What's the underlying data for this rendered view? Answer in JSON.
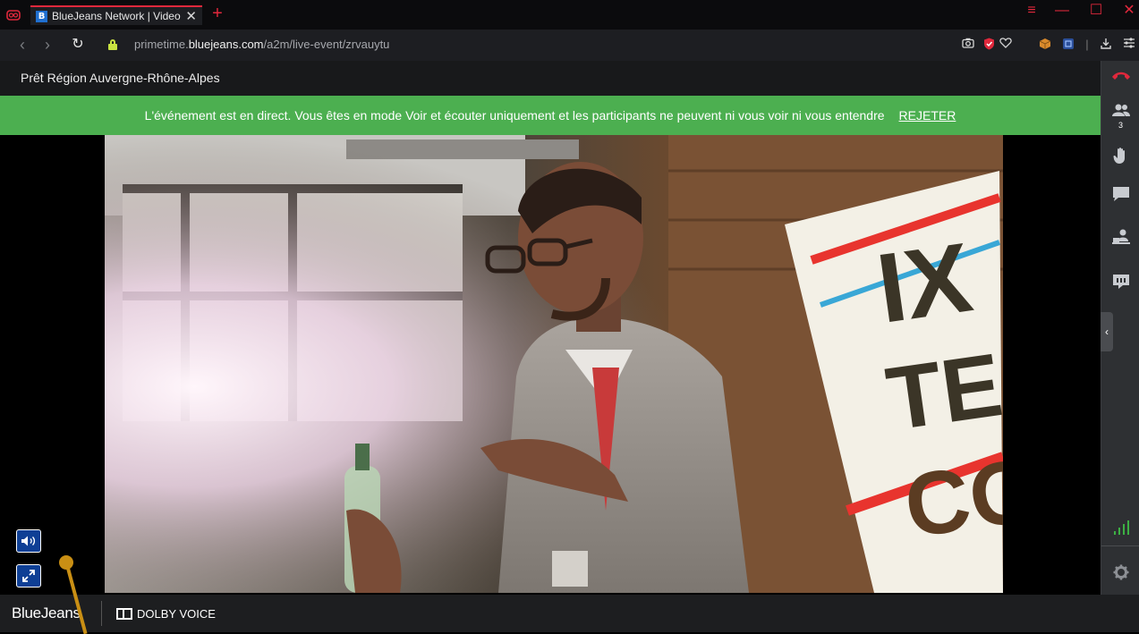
{
  "browser": {
    "tab": {
      "favicon": "B",
      "title": "BlueJeans Network | Video",
      "close_label": "✕"
    },
    "new_tab_label": "+",
    "window_controls": {
      "menu": "≡",
      "minimize": "—",
      "maximize": "☐",
      "close": "✕"
    },
    "url": {
      "prefix": "primetime.",
      "domain": "bluejeans.com",
      "path": "/a2m/live-event/zrvauytu"
    }
  },
  "meeting": {
    "title": "Prêt Région Auvergne-Rhône-Alpes",
    "notice": {
      "text": "L'événement est en direct. Vous êtes en mode Voir et écouter uniquement et les participants ne peuvent ni vous voir ni vous entendre",
      "dismiss_label": "REJETER"
    },
    "video": {
      "banner_text_1": "IX",
      "banner_text_2": "TE",
      "banner_text_3": "CO"
    },
    "controls": {
      "volume_icon": "speaker-icon",
      "fullscreen_icon": "expand-icon"
    },
    "sidebar": {
      "participants_count": "3",
      "items": [
        {
          "icon": "hangup-icon"
        },
        {
          "icon": "participants-icon"
        },
        {
          "icon": "raise-hand-icon"
        },
        {
          "icon": "chat-icon"
        },
        {
          "icon": "share-icon"
        },
        {
          "icon": "qa-icon"
        },
        {
          "icon": "signal-icon"
        },
        {
          "icon": "gear-icon"
        }
      ]
    }
  },
  "footer": {
    "brand": "BlueJeans",
    "dolby_label": "DOLBY VOICE"
  },
  "colors": {
    "notice_green": "#4caf50",
    "accent_red": "#e0283c",
    "control_blue": "#0e3f95",
    "signal_green": "#3cb043",
    "pointer_gold": "#c98f14"
  }
}
